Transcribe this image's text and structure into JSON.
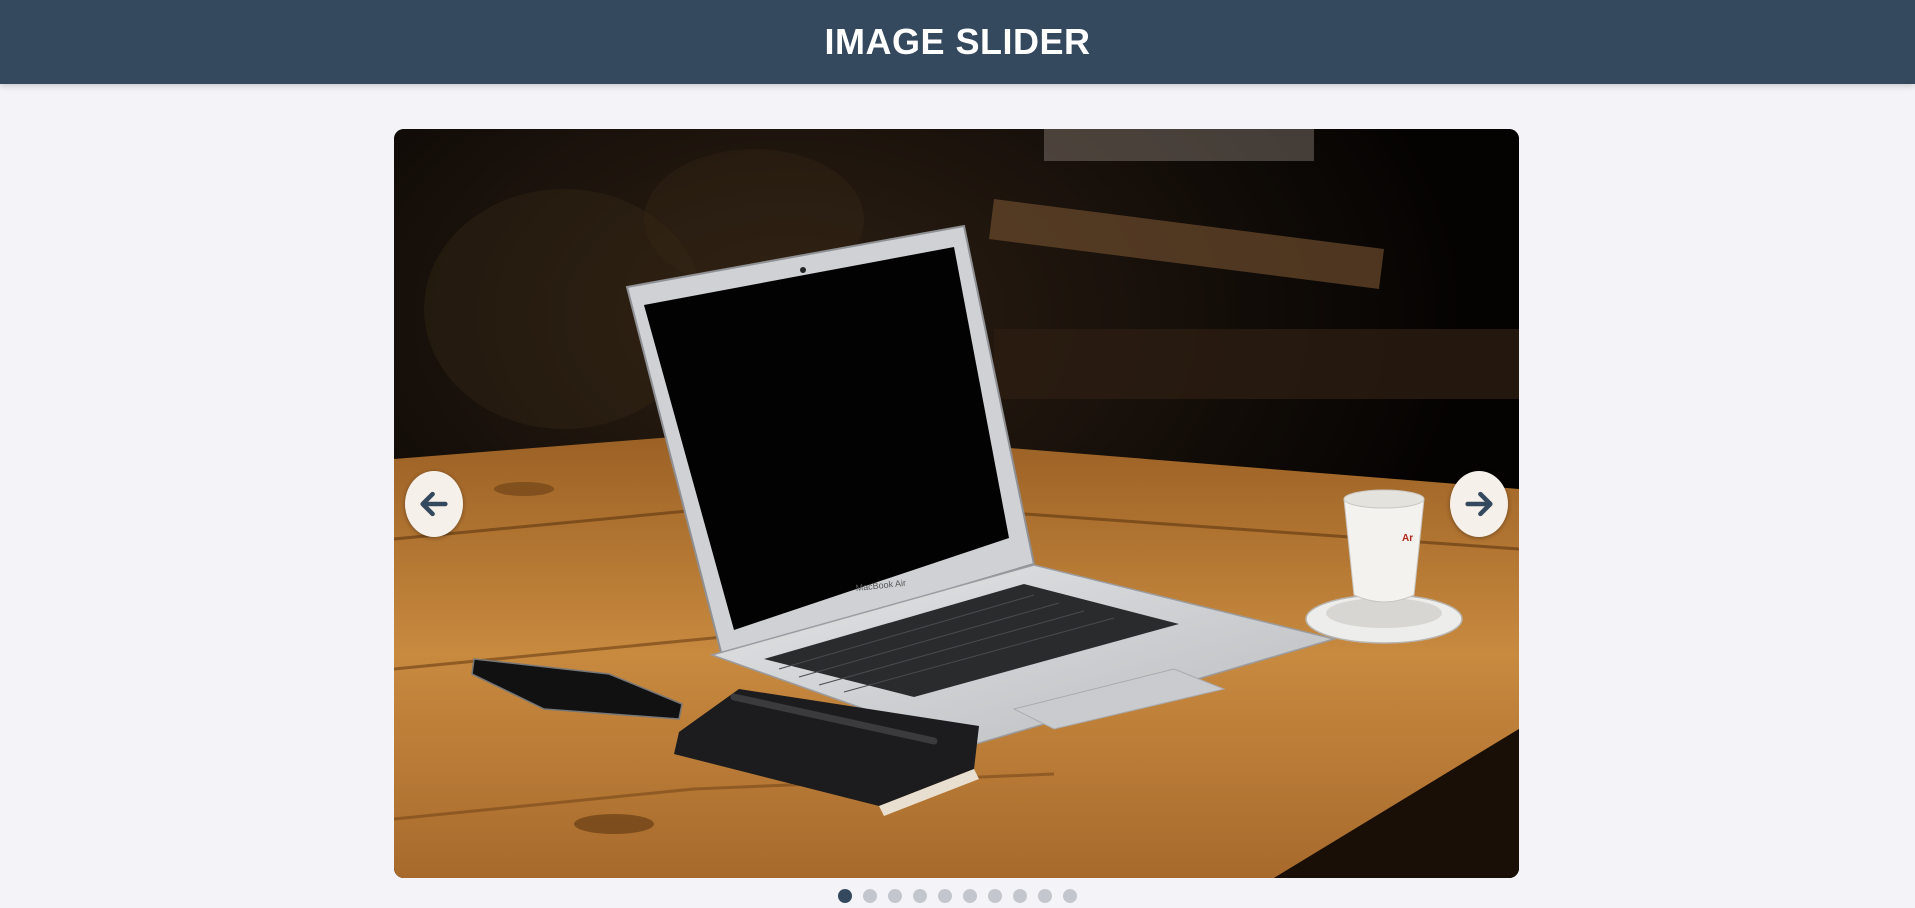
{
  "header": {
    "title": "IMAGE SLIDER"
  },
  "slider": {
    "current_slide": 1,
    "total_slides": 10,
    "prev_icon": "arrow-left-icon",
    "next_icon": "arrow-right-icon",
    "image_subject": "laptop-on-wooden-table",
    "laptop_label": "MacBook Air"
  },
  "colors": {
    "header_bg": "#34495e",
    "page_bg": "#f4f4f8",
    "dot_active": "#34495e",
    "dot_inactive": "#c3c6cc",
    "nav_button_bg": "#f5f0ea"
  }
}
